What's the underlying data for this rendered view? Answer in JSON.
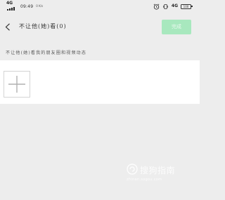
{
  "status_bar": {
    "left_network_type": "4G",
    "time": "09:49",
    "net_speed": "0 K/s",
    "right_network_type": "4G",
    "battery": "100"
  },
  "header": {
    "title": "不让他(她)看(0)",
    "done_label": "完成"
  },
  "description": "不让他(她)看我的朋友圈和视频动态",
  "add_member_icon": "plus-icon",
  "watermark": {
    "name": "搜狗指南",
    "url": "zhinan.sogou.com"
  },
  "colors": {
    "background": "#ededed",
    "panel": "#ffffff",
    "done_button_disabled": "#a8e8be"
  }
}
